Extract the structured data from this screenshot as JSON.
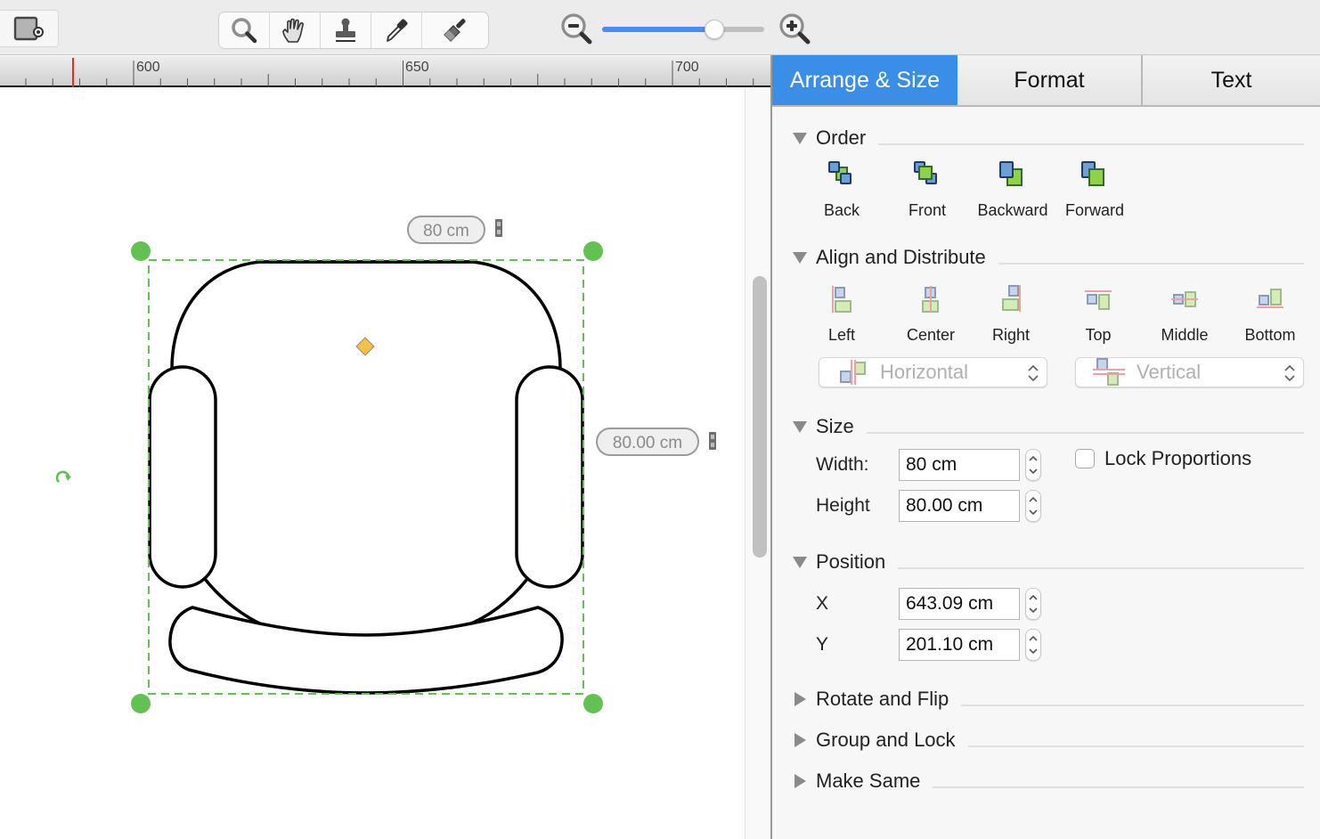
{
  "toolbar": {
    "tools": [
      {
        "name": "zoom-tool",
        "icon": "magnifier-icon"
      },
      {
        "name": "pan-tool",
        "icon": "hand-icon"
      },
      {
        "name": "stamp-tool",
        "icon": "stamp-icon"
      },
      {
        "name": "eyedropper-tool",
        "icon": "eyedropper-icon"
      },
      {
        "name": "format-painter-tool",
        "icon": "paintbrush-icon"
      }
    ],
    "zoom_level_fraction": 0.72
  },
  "ruler": {
    "labels": [
      "600",
      "650",
      "700"
    ],
    "marker_color": "#e03020"
  },
  "canvas": {
    "shape": "armchair",
    "width_label": "80 cm",
    "height_label": "80.00 cm",
    "selection_color": "#62c152",
    "handle_color": "#f5c242"
  },
  "sidebar": {
    "tabs": [
      {
        "label": "Arrange & Size",
        "active": true
      },
      {
        "label": "Format",
        "active": false
      },
      {
        "label": "Text",
        "active": false
      }
    ],
    "accent": "#3a8ee6",
    "order": {
      "title": "Order",
      "buttons": [
        "Back",
        "Front",
        "Backward",
        "Forward"
      ]
    },
    "align": {
      "title": "Align and Distribute",
      "buttons": [
        "Left",
        "Center",
        "Right",
        "Top",
        "Middle",
        "Bottom"
      ],
      "horizontal": "Horizontal",
      "vertical": "Vertical"
    },
    "size": {
      "title": "Size",
      "width_label": "Width:",
      "width_value": "80 cm",
      "height_label": "Height",
      "height_value": "80.00 cm",
      "lock_label": "Lock Proportions",
      "lock_checked": false
    },
    "position": {
      "title": "Position",
      "x_label": "X",
      "x_value": "643.09 cm",
      "y_label": "Y",
      "y_value": "201.10 cm"
    },
    "collapsed": [
      "Rotate and Flip",
      "Group and Lock",
      "Make Same"
    ]
  }
}
